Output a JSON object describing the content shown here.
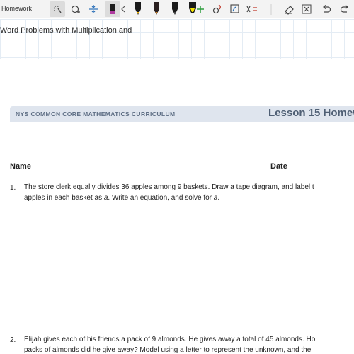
{
  "toolbar": {
    "title": "Homework",
    "icons": [
      "lasso-select-icon",
      "add-shape-icon",
      "insert-space-icon",
      "marker-pen-icon",
      "chevron-left-icon",
      "pen-black-icon",
      "pen-brown-icon",
      "pen-dark-icon",
      "highlighter-yellow-icon",
      "add-pen-icon",
      "ink-to-shape-icon",
      "ink-to-text-icon",
      "ink-to-math-icon",
      "eraser-icon",
      "close-icon",
      "undo-icon",
      "redo-icon"
    ],
    "colors": {
      "marker": "#b03aa0",
      "highlighter": "#f5e400",
      "accent_green": "#2e9e3e"
    }
  },
  "notebook": {
    "page_heading": "Word Problems with Multiplication and"
  },
  "worksheet": {
    "banner_left": "NYS COMMON CORE MATHEMATICS CURRICULUM",
    "banner_right": "Lesson 15 Homew",
    "name_label": "Name",
    "date_label": "Date",
    "questions": [
      {
        "number": "1.",
        "line1": "The store clerk equally divides 36 apples among 9 baskets.  Draw a tape diagram, and label t",
        "line2_pre": "apples in each basket as ",
        "line2_var": "a",
        "line2_mid": ".  Write an equation, and solve for ",
        "line2_var2": "a",
        "line2_end": "."
      },
      {
        "number": "2.",
        "line1": "Elijah gives each of his friends a pack of 9 almonds.  He gives away a total of 45 almonds.  Ho",
        "line2": "packs of almonds did he give away?  Model using a letter to represent the unknown, and the"
      }
    ]
  }
}
